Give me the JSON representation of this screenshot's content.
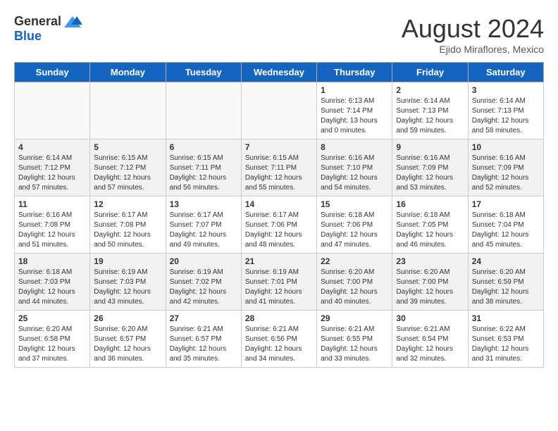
{
  "header": {
    "logo_general": "General",
    "logo_blue": "Blue",
    "month_year": "August 2024",
    "location": "Ejido Miraflores, Mexico"
  },
  "weekdays": [
    "Sunday",
    "Monday",
    "Tuesday",
    "Wednesday",
    "Thursday",
    "Friday",
    "Saturday"
  ],
  "weeks": [
    [
      {
        "day": "",
        "info": ""
      },
      {
        "day": "",
        "info": ""
      },
      {
        "day": "",
        "info": ""
      },
      {
        "day": "",
        "info": ""
      },
      {
        "day": "1",
        "info": "Sunrise: 6:13 AM\nSunset: 7:14 PM\nDaylight: 13 hours\nand 0 minutes."
      },
      {
        "day": "2",
        "info": "Sunrise: 6:14 AM\nSunset: 7:13 PM\nDaylight: 12 hours\nand 59 minutes."
      },
      {
        "day": "3",
        "info": "Sunrise: 6:14 AM\nSunset: 7:13 PM\nDaylight: 12 hours\nand 58 minutes."
      }
    ],
    [
      {
        "day": "4",
        "info": "Sunrise: 6:14 AM\nSunset: 7:12 PM\nDaylight: 12 hours\nand 57 minutes."
      },
      {
        "day": "5",
        "info": "Sunrise: 6:15 AM\nSunset: 7:12 PM\nDaylight: 12 hours\nand 57 minutes."
      },
      {
        "day": "6",
        "info": "Sunrise: 6:15 AM\nSunset: 7:11 PM\nDaylight: 12 hours\nand 56 minutes."
      },
      {
        "day": "7",
        "info": "Sunrise: 6:15 AM\nSunset: 7:11 PM\nDaylight: 12 hours\nand 55 minutes."
      },
      {
        "day": "8",
        "info": "Sunrise: 6:16 AM\nSunset: 7:10 PM\nDaylight: 12 hours\nand 54 minutes."
      },
      {
        "day": "9",
        "info": "Sunrise: 6:16 AM\nSunset: 7:09 PM\nDaylight: 12 hours\nand 53 minutes."
      },
      {
        "day": "10",
        "info": "Sunrise: 6:16 AM\nSunset: 7:09 PM\nDaylight: 12 hours\nand 52 minutes."
      }
    ],
    [
      {
        "day": "11",
        "info": "Sunrise: 6:16 AM\nSunset: 7:08 PM\nDaylight: 12 hours\nand 51 minutes."
      },
      {
        "day": "12",
        "info": "Sunrise: 6:17 AM\nSunset: 7:08 PM\nDaylight: 12 hours\nand 50 minutes."
      },
      {
        "day": "13",
        "info": "Sunrise: 6:17 AM\nSunset: 7:07 PM\nDaylight: 12 hours\nand 49 minutes."
      },
      {
        "day": "14",
        "info": "Sunrise: 6:17 AM\nSunset: 7:06 PM\nDaylight: 12 hours\nand 48 minutes."
      },
      {
        "day": "15",
        "info": "Sunrise: 6:18 AM\nSunset: 7:06 PM\nDaylight: 12 hours\nand 47 minutes."
      },
      {
        "day": "16",
        "info": "Sunrise: 6:18 AM\nSunset: 7:05 PM\nDaylight: 12 hours\nand 46 minutes."
      },
      {
        "day": "17",
        "info": "Sunrise: 6:18 AM\nSunset: 7:04 PM\nDaylight: 12 hours\nand 45 minutes."
      }
    ],
    [
      {
        "day": "18",
        "info": "Sunrise: 6:18 AM\nSunset: 7:03 PM\nDaylight: 12 hours\nand 44 minutes."
      },
      {
        "day": "19",
        "info": "Sunrise: 6:19 AM\nSunset: 7:03 PM\nDaylight: 12 hours\nand 43 minutes."
      },
      {
        "day": "20",
        "info": "Sunrise: 6:19 AM\nSunset: 7:02 PM\nDaylight: 12 hours\nand 42 minutes."
      },
      {
        "day": "21",
        "info": "Sunrise: 6:19 AM\nSunset: 7:01 PM\nDaylight: 12 hours\nand 41 minutes."
      },
      {
        "day": "22",
        "info": "Sunrise: 6:20 AM\nSunset: 7:00 PM\nDaylight: 12 hours\nand 40 minutes."
      },
      {
        "day": "23",
        "info": "Sunrise: 6:20 AM\nSunset: 7:00 PM\nDaylight: 12 hours\nand 39 minutes."
      },
      {
        "day": "24",
        "info": "Sunrise: 6:20 AM\nSunset: 6:59 PM\nDaylight: 12 hours\nand 38 minutes."
      }
    ],
    [
      {
        "day": "25",
        "info": "Sunrise: 6:20 AM\nSunset: 6:58 PM\nDaylight: 12 hours\nand 37 minutes."
      },
      {
        "day": "26",
        "info": "Sunrise: 6:20 AM\nSunset: 6:57 PM\nDaylight: 12 hours\nand 36 minutes."
      },
      {
        "day": "27",
        "info": "Sunrise: 6:21 AM\nSunset: 6:57 PM\nDaylight: 12 hours\nand 35 minutes."
      },
      {
        "day": "28",
        "info": "Sunrise: 6:21 AM\nSunset: 6:56 PM\nDaylight: 12 hours\nand 34 minutes."
      },
      {
        "day": "29",
        "info": "Sunrise: 6:21 AM\nSunset: 6:55 PM\nDaylight: 12 hours\nand 33 minutes."
      },
      {
        "day": "30",
        "info": "Sunrise: 6:21 AM\nSunset: 6:54 PM\nDaylight: 12 hours\nand 32 minutes."
      },
      {
        "day": "31",
        "info": "Sunrise: 6:22 AM\nSunset: 6:53 PM\nDaylight: 12 hours\nand 31 minutes."
      }
    ]
  ]
}
